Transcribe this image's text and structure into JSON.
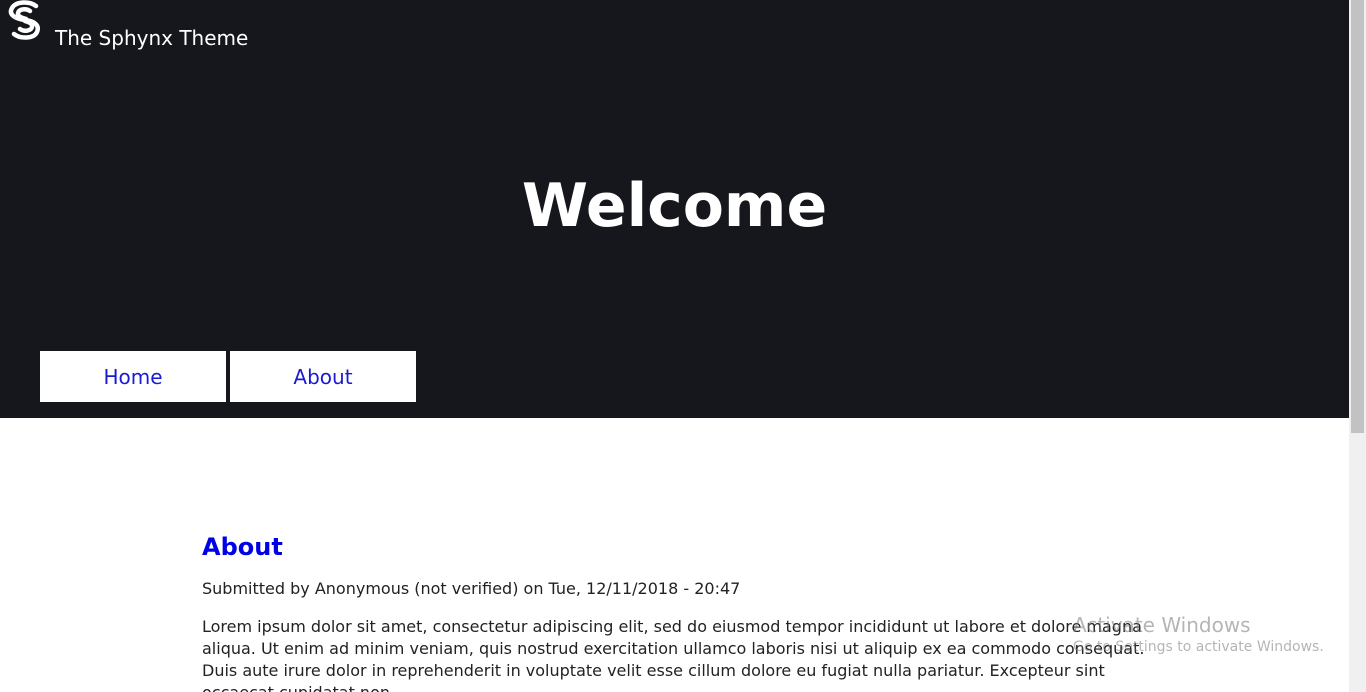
{
  "site": {
    "name": "The Sphynx Theme",
    "logo_icon": "spiral-s-logo-icon"
  },
  "hero": {
    "title": "Welcome"
  },
  "nav": {
    "items": [
      {
        "label": "Home"
      },
      {
        "label": "About"
      }
    ]
  },
  "article": {
    "title": "About",
    "submitted": "Submitted by Anonymous (not verified) on Tue, 12/11/2018 - 20:47",
    "body": "Lorem ipsum dolor sit amet, consectetur adipiscing elit, sed do eiusmod tempor incididunt ut labore et dolore magna aliqua. Ut enim ad minim veniam, quis nostrud exercitation ullamco laboris nisi ut aliquip ex ea commodo consequat. Duis aute irure dolor in reprehenderit in voluptate velit esse cillum dolore eu fugiat nulla pariatur. Excepteur sint occaecat cupidatat non"
  },
  "watermark": {
    "title": "Activate Windows",
    "subtitle": "Go to Settings to activate Windows."
  },
  "colors": {
    "header_bg": "#15171c",
    "link": "#0000e6",
    "nav_text": "#1a1ad6"
  }
}
